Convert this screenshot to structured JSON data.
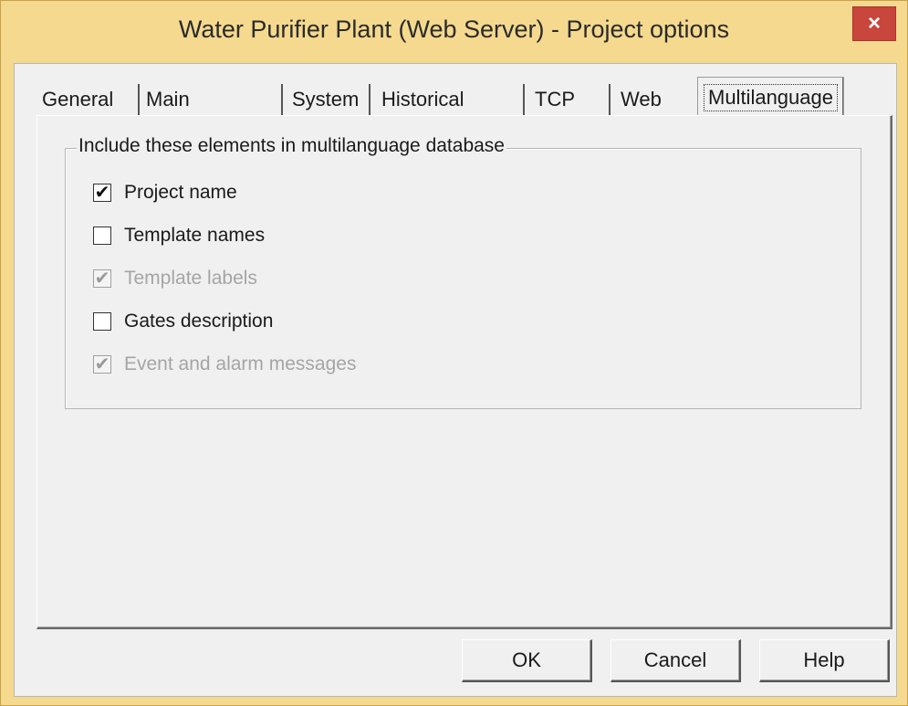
{
  "window": {
    "title": "Water Purifier Plant (Web Server) - Project options",
    "close_glyph": "×"
  },
  "tabs": [
    {
      "label": "General"
    },
    {
      "label": "Main window"
    },
    {
      "label": "System"
    },
    {
      "label": "Historical files"
    },
    {
      "label": "TCP"
    },
    {
      "label": "Web"
    },
    {
      "label": "Multilanguage",
      "active": true
    }
  ],
  "group": {
    "legend": "Include these elements in multilanguage database",
    "items": [
      {
        "label": "Project name",
        "checked": true,
        "enabled": true,
        "mark": "✔"
      },
      {
        "label": "Template names",
        "checked": false,
        "enabled": true,
        "mark": ""
      },
      {
        "label": "Template labels",
        "checked": true,
        "enabled": false,
        "mark": "✔"
      },
      {
        "label": "Gates description",
        "checked": false,
        "enabled": true,
        "mark": ""
      },
      {
        "label": "Event and alarm messages",
        "checked": true,
        "enabled": false,
        "mark": "✔"
      }
    ]
  },
  "buttons": {
    "ok": "OK",
    "cancel": "Cancel",
    "help": "Help"
  },
  "colors": {
    "title_bar": "#f5d98e",
    "close_button": "#c9463d",
    "dialog_bg": "#f0f0f0"
  }
}
